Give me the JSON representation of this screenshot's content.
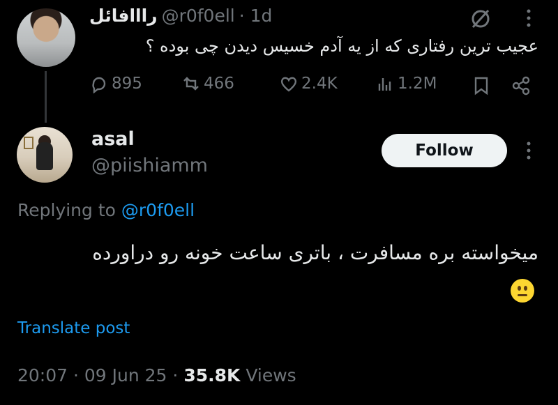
{
  "parent": {
    "author_name": "رااافائل",
    "handle": "@r0f0ell",
    "time": "· 1d",
    "text": "عجیب ترین رفتاری که از یه آدم خسیس دیدن چی بوده ؟",
    "stats": {
      "replies": "895",
      "reposts": "466",
      "likes": "2.4K",
      "views": "1.2M"
    }
  },
  "reply": {
    "author_name": "asal",
    "handle": "@piishiamm",
    "follow_label": "Follow",
    "replying_prefix": "Replying to",
    "replying_handle": "@r0f0ell",
    "text": "میخواسته بره مسافرت ، باتری ساعت خونه رو دراورده",
    "emoji": "neutral-face",
    "translate_label": "Translate post",
    "timestamp": "20:07 · 09 Jun 25 ·",
    "views_count": "35.8K",
    "views_label": "Views"
  },
  "colors": {
    "background": "#000000",
    "text": "#e7e9ea",
    "muted": "#71767b",
    "link": "#1d9bf0",
    "button": "#eff3f4"
  }
}
